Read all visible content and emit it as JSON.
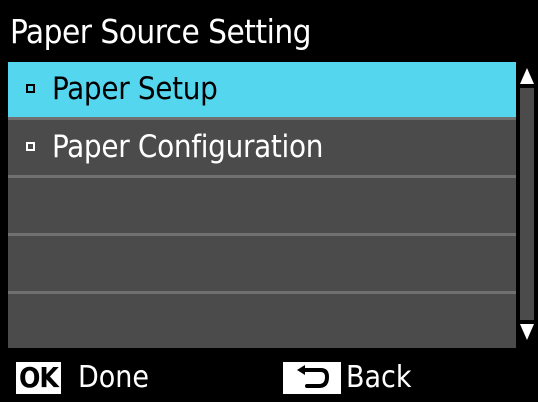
{
  "screen": {
    "title": "Paper Source Setting"
  },
  "menu": {
    "items": [
      {
        "label": "Paper Setup",
        "selected": true
      },
      {
        "label": "Paper Configuration",
        "selected": false
      },
      {
        "label": "",
        "selected": false
      },
      {
        "label": "",
        "selected": false
      },
      {
        "label": "",
        "selected": false
      }
    ]
  },
  "footer": {
    "ok_key": "OK",
    "ok_label": "Done",
    "back_key_icon": "back-arrow-icon",
    "back_label": "Back"
  },
  "colors": {
    "background": "#000000",
    "selected_row": "#55d6ef",
    "row": "#4b4b4b",
    "row_separator": "#707070",
    "text": "#ffffff"
  }
}
